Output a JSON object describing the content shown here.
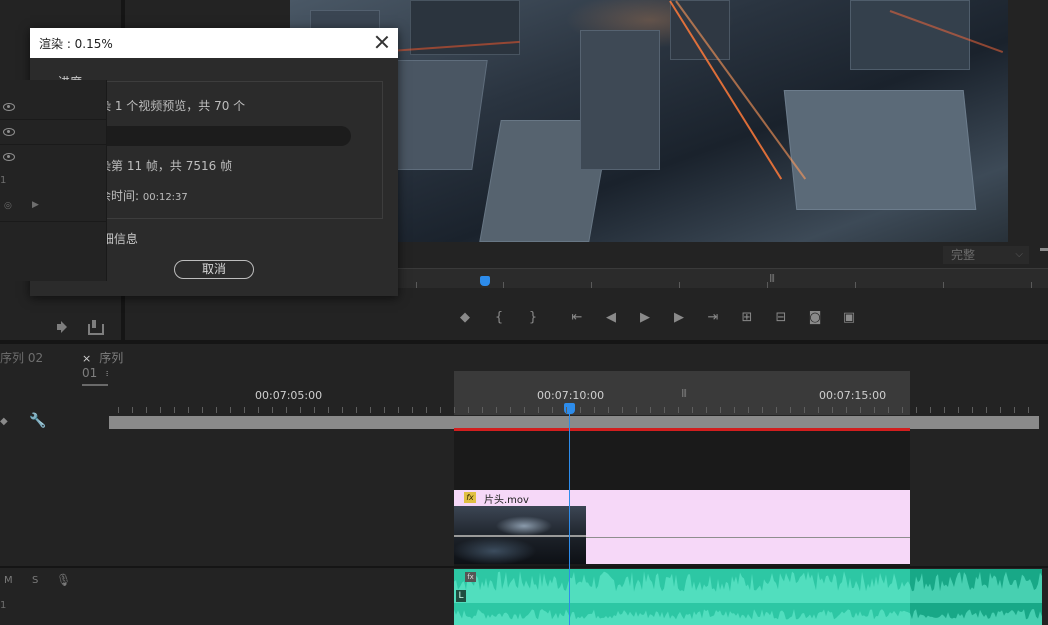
{
  "dialog": {
    "title": "渲染 : 0.15%",
    "progress_group": "进度",
    "line_previews": "正在渲染 1 个视频预览，共 70 个",
    "progress_fraction": 0.0015,
    "line_frames": "正在渲染第 11 帧，共 7516 帧",
    "time_remaining_label": "预计剩余时间: ",
    "time_remaining_value": "00:12:37",
    "details_label": "渲染详细信息",
    "details_chevron": "›",
    "cancel_label": "取消"
  },
  "program": {
    "zoom_value": "完整"
  },
  "timeline": {
    "tabs": [
      {
        "label": "序列 02"
      },
      {
        "label": "序列 01",
        "close": "×",
        "menu": "≡"
      }
    ],
    "timecodes": [
      "00:07:05:00",
      "00:07:10:00",
      "00:07:15:00"
    ],
    "clip_name": "片头.mov",
    "fx_badge": "fx",
    "audio_channel": "L",
    "audio_header": {
      "m": "M",
      "s": "S"
    },
    "track_numbers": [
      "1",
      "1"
    ]
  },
  "colors": {
    "accent": "#2d8ceb",
    "clip_video": "#f6d8f8",
    "clip_audio": "#2dc7a4",
    "render_bar": "#d21e1e"
  }
}
